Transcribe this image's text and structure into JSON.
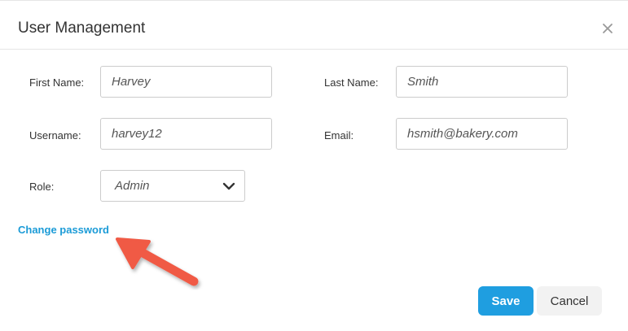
{
  "dialog": {
    "title": "User Management",
    "close_icon": "close-icon"
  },
  "form": {
    "first_name": {
      "label": "First Name:",
      "value": "Harvey"
    },
    "last_name": {
      "label": "Last Name:",
      "value": "Smith"
    },
    "username": {
      "label": "Username:",
      "value": "harvey12"
    },
    "email": {
      "label": "Email:",
      "value": "hsmith@bakery.com"
    },
    "role": {
      "label": "Role:",
      "value": "Admin",
      "icon": "chevron-down-icon"
    }
  },
  "links": {
    "change_password": "Change password"
  },
  "annotation": {
    "icon": "red-arrow-icon",
    "color": "#f05a45"
  },
  "buttons": {
    "save": "Save",
    "cancel": "Cancel"
  },
  "colors": {
    "accent": "#1f9ee0",
    "link": "#1b9bd7",
    "border": "#cccccc"
  }
}
